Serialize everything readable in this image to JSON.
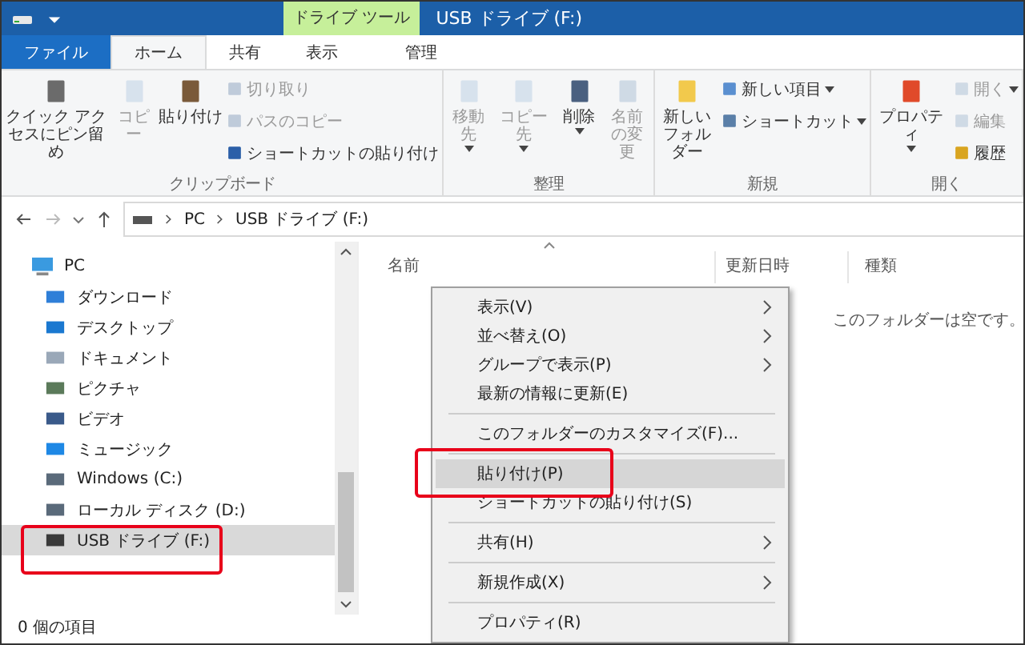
{
  "window": {
    "title": "USB ドライブ (F:)",
    "context_tab_label": "ドライブ ツール"
  },
  "tabs": [
    {
      "label": "ファイル",
      "kind": "file",
      "selected": false
    },
    {
      "label": "ホーム",
      "kind": "tab",
      "selected": true
    },
    {
      "label": "共有",
      "kind": "tab",
      "selected": false
    },
    {
      "label": "表示",
      "kind": "tab",
      "selected": false
    },
    {
      "label": "管理",
      "kind": "context",
      "selected": false
    }
  ],
  "ribbon": {
    "groups": [
      {
        "label": "クリップボード",
        "buttons": [
          {
            "label": "クイック アクセスにピン留め",
            "kind": "large",
            "disabled": false,
            "dropdown": false
          },
          {
            "label": "コピー",
            "kind": "large",
            "disabled": true,
            "dropdown": false
          },
          {
            "label": "貼り付け",
            "kind": "large",
            "disabled": false,
            "dropdown": false
          },
          {
            "label": "切り取り",
            "kind": "small",
            "disabled": true,
            "dropdown": false
          },
          {
            "label": "パスのコピー",
            "kind": "small",
            "disabled": true,
            "dropdown": false
          },
          {
            "label": "ショートカットの貼り付け",
            "kind": "small",
            "disabled": false,
            "dropdown": false
          }
        ]
      },
      {
        "label": "整理",
        "buttons": [
          {
            "label": "移動先",
            "kind": "large",
            "disabled": true,
            "dropdown": true
          },
          {
            "label": "コピー先",
            "kind": "large",
            "disabled": true,
            "dropdown": true
          },
          {
            "label": "削除",
            "kind": "large",
            "disabled": false,
            "dropdown": true
          },
          {
            "label": "名前の変更",
            "kind": "large",
            "disabled": true,
            "dropdown": false
          }
        ]
      },
      {
        "label": "新規",
        "buttons": [
          {
            "label": "新しいフォルダー",
            "kind": "large",
            "disabled": false,
            "dropdown": false
          },
          {
            "label": "新しい項目",
            "kind": "small",
            "disabled": false,
            "dropdown": true
          },
          {
            "label": "ショートカット",
            "kind": "small",
            "disabled": false,
            "dropdown": true
          }
        ]
      },
      {
        "label": "開く",
        "buttons": [
          {
            "label": "プロパティ",
            "kind": "large",
            "disabled": false,
            "dropdown": true
          },
          {
            "label": "開く",
            "kind": "small",
            "disabled": true,
            "dropdown": true
          },
          {
            "label": "編集",
            "kind": "small",
            "disabled": true,
            "dropdown": false
          },
          {
            "label": "履歴",
            "kind": "small",
            "disabled": false,
            "dropdown": false
          }
        ]
      }
    ]
  },
  "address_bar": {
    "path": [
      "PC",
      "USB ドライブ (F:)"
    ]
  },
  "sidebar": {
    "items": [
      {
        "label": "PC",
        "selected": false,
        "children": [
          {
            "label": "ダウンロード",
            "selected": false
          },
          {
            "label": "デスクトップ",
            "selected": false
          },
          {
            "label": "ドキュメント",
            "selected": false
          },
          {
            "label": "ピクチャ",
            "selected": false
          },
          {
            "label": "ビデオ",
            "selected": false
          },
          {
            "label": "ミュージック",
            "selected": false
          },
          {
            "label": "Windows (C:)",
            "selected": false
          },
          {
            "label": "ローカル ディスク (D:)",
            "selected": false
          },
          {
            "label": "USB ドライブ (F:)",
            "selected": true
          }
        ]
      }
    ]
  },
  "file_list": {
    "columns": [
      "名前",
      "更新日時",
      "種類"
    ],
    "empty_message": "このフォルダーは空です。"
  },
  "context_menu": {
    "items": [
      {
        "kind": "item",
        "label": "表示(V)",
        "submenu": true,
        "selected": false
      },
      {
        "kind": "item",
        "label": "並べ替え(O)",
        "submenu": true,
        "selected": false
      },
      {
        "kind": "item",
        "label": "グループで表示(P)",
        "submenu": true,
        "selected": false
      },
      {
        "kind": "item",
        "label": "最新の情報に更新(E)",
        "submenu": false,
        "selected": false
      },
      {
        "kind": "separator"
      },
      {
        "kind": "item",
        "label": "このフォルダーのカスタマイズ(F)...",
        "submenu": false,
        "selected": false
      },
      {
        "kind": "separator"
      },
      {
        "kind": "item",
        "label": "貼り付け(P)",
        "submenu": false,
        "selected": true
      },
      {
        "kind": "item",
        "label": "ショートカットの貼り付け(S)",
        "submenu": false,
        "selected": false
      },
      {
        "kind": "separator"
      },
      {
        "kind": "item",
        "label": "共有(H)",
        "submenu": true,
        "selected": false
      },
      {
        "kind": "separator"
      },
      {
        "kind": "item",
        "label": "新規作成(X)",
        "submenu": true,
        "selected": false
      },
      {
        "kind": "separator"
      },
      {
        "kind": "item",
        "label": "プロパティ(R)",
        "submenu": false,
        "selected": false
      }
    ]
  },
  "status_bar": {
    "text": "0 個の項目"
  }
}
